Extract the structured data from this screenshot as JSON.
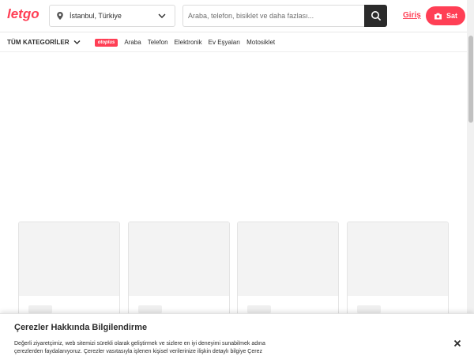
{
  "header": {
    "logo_text": "letgo",
    "location": "İstanbul, Türkiye",
    "search_placeholder": "Araba, telefon, bisiklet ve daha fazlası...",
    "login_label": "Giriş",
    "sell_label": "Sat"
  },
  "categories": {
    "all_label": "TÜM KATEGORİLER",
    "badge": "otoplus",
    "items": [
      "Araba",
      "Telefon",
      "Elektronik",
      "Ev Eşyaları",
      "Motosiklet"
    ]
  },
  "cookie": {
    "title": "Çerezler Hakkında Bilgilendirme",
    "body": "Değerli ziyaretçimiz, web sitemizi sürekli olarak geliştirmek ve sizlere en iyi deneyimi sunabilmek adına çerezlerden faydalanıyoruz. Çerezler vasıtasıyla işlenen kişisel verilerinize ilişkin detaylı bilgiye Çerez"
  },
  "colors": {
    "brand": "#ff3f55",
    "search_button": "#2b2b2b"
  },
  "icons": {
    "location": "map-pin-icon",
    "dropdown": "chevron-down-icon",
    "search": "search-icon",
    "sell": "camera-icon",
    "close": "close-icon"
  }
}
